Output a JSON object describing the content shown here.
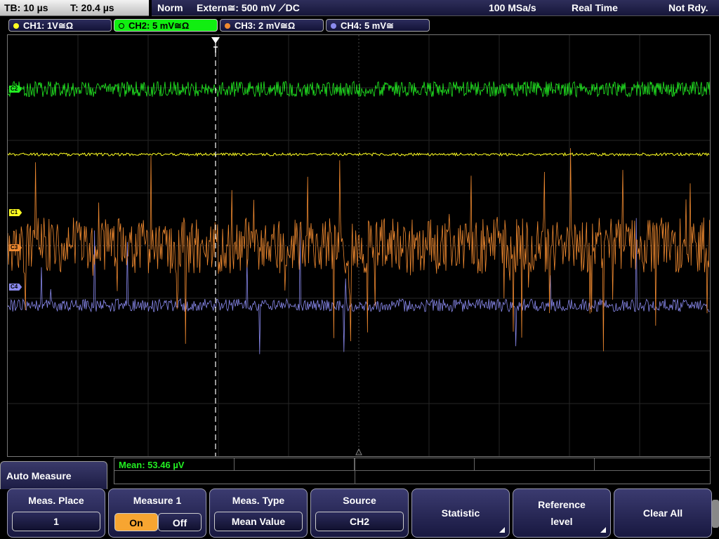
{
  "status": {
    "timebase": "TB: 10 µs",
    "trigger_time": "T: 20.4 µs",
    "mode": "Norm",
    "trigger": "Extern≅: 500 mV ⟋DC",
    "sample_rate": "100 MSa/s",
    "acquisition": "Real Time",
    "state": "Not Rdy."
  },
  "channels": [
    {
      "label": "CH1: 1V≅Ω",
      "color": "#ffff22",
      "marker": "C1"
    },
    {
      "label": "CH2: 5 mV≅Ω",
      "color": "#22ee22",
      "marker": "C2"
    },
    {
      "label": "CH3: 2 mV≅Ω",
      "color": "#f08a30",
      "marker": "C3"
    },
    {
      "label": "CH4: 5 mV≅",
      "color": "#8a8aee",
      "marker": "C4"
    }
  ],
  "measurement": {
    "result": "Mean: 53.46 µV"
  },
  "menu": {
    "title": "Auto Measure",
    "meas_place": {
      "label": "Meas. Place",
      "value": "1"
    },
    "measure": {
      "label": "Measure 1",
      "on": "On",
      "off": "Off",
      "selected": "On"
    },
    "meas_type": {
      "label": "Meas. Type",
      "value": "Mean Value"
    },
    "source": {
      "label": "Source",
      "value": "CH2"
    },
    "statistic": "Statistic",
    "reference_line1": "Reference",
    "reference_line2": "level",
    "clear_all": "Clear All"
  }
}
